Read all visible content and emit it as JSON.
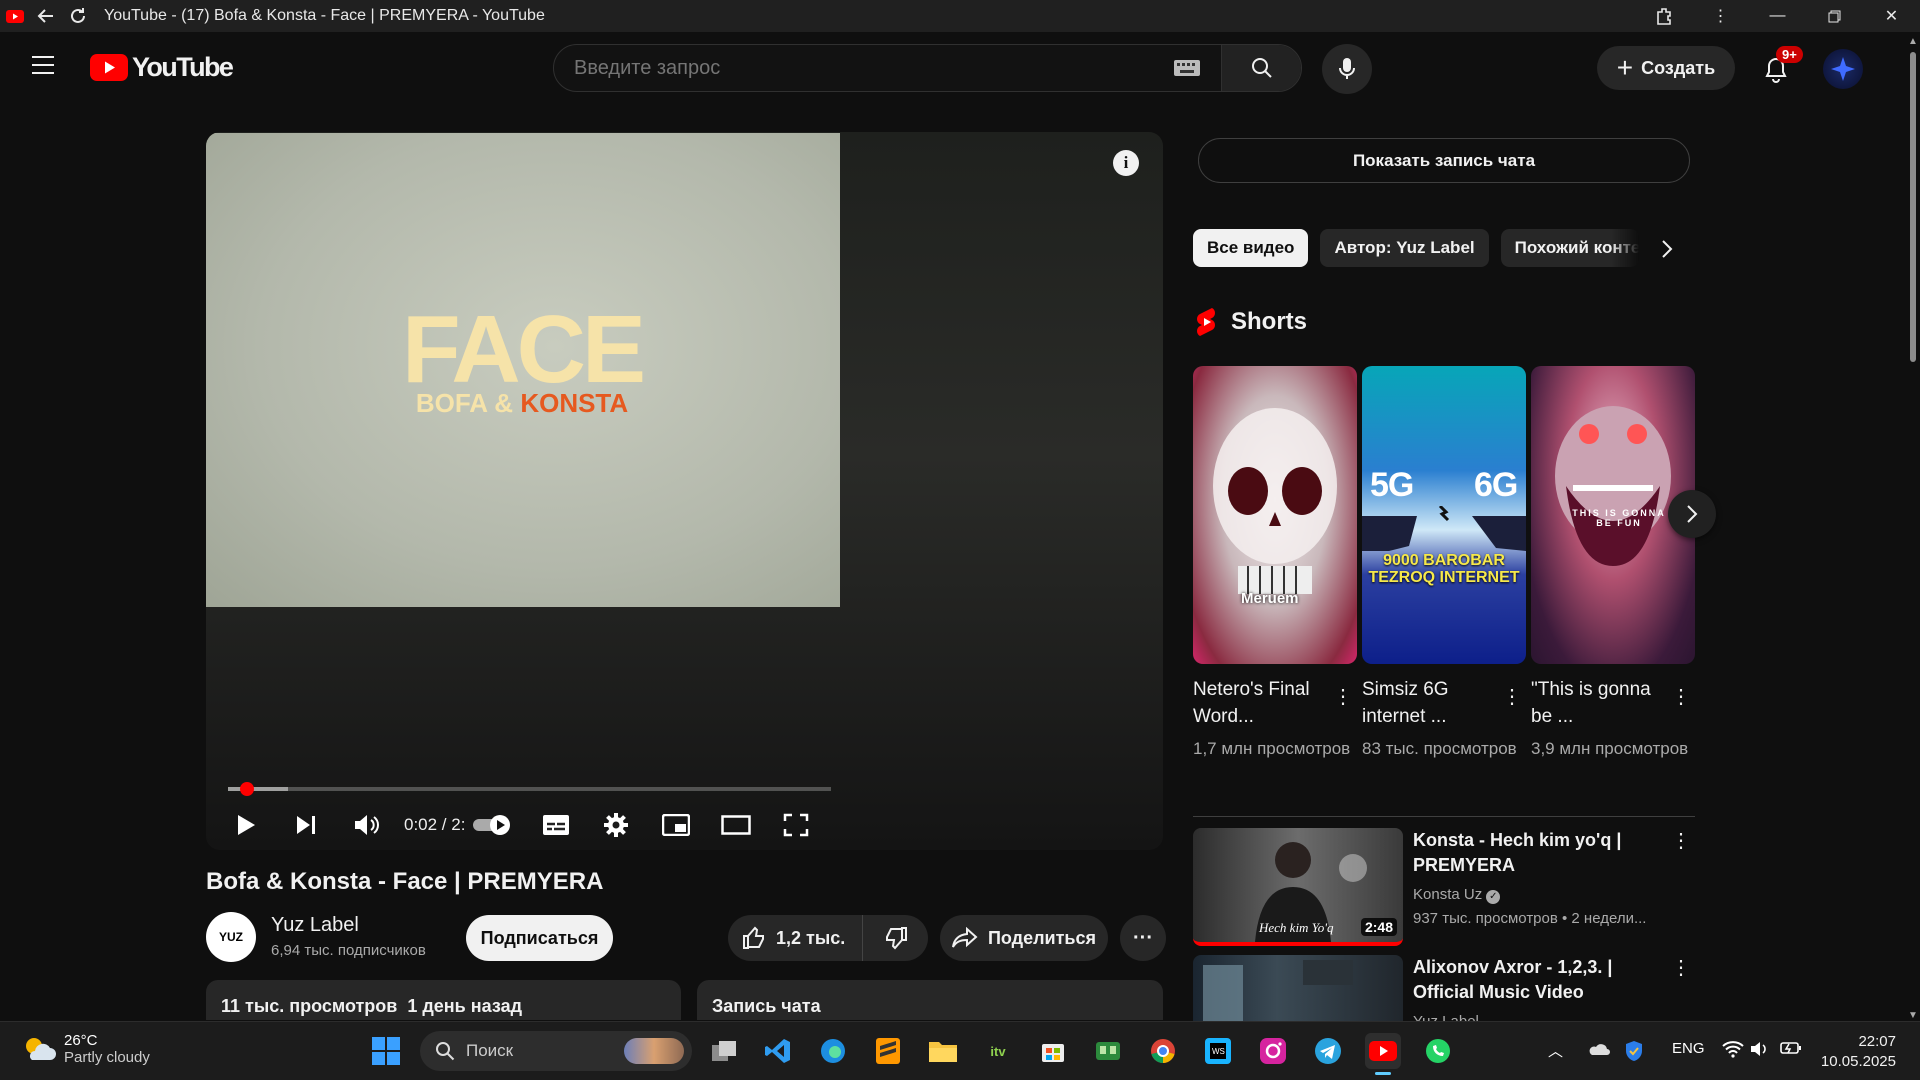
{
  "browser": {
    "title": "YouTube - (17) Bofa & Konsta - Face | PREMYERA - YouTube"
  },
  "header": {
    "logo_text": "YouTube",
    "search_placeholder": "Введите запрос",
    "create_label": "Создать",
    "notif_badge": "9+"
  },
  "player": {
    "cover_title": "FACE",
    "cover_artist_left": "BOFA &",
    "cover_artist_right": "KONSTA",
    "time": "0:02 / 2:",
    "progress_fraction": 0.02
  },
  "video": {
    "title": "Bofa & Konsta - Face | PREMYERA",
    "channel": "Yuz Label",
    "channel_avatar_text": "YUZ",
    "subscribers": "6,94 тыс. подписчиков",
    "subscribe_label": "Подписаться",
    "likes": "1,2 тыс.",
    "share_label": "Поделиться",
    "more_label": "···",
    "views_date": "11 тыс. просмотров  1 день назад",
    "chat_record_label": "Запись чата"
  },
  "sidebar": {
    "show_chat": "Показать запись чата",
    "chips": [
      "Все видео",
      "Автор: Yuz Label",
      "Похожий конте"
    ],
    "shorts_heading": "Shorts",
    "shorts": [
      {
        "title": "Netero's Final Word...",
        "views": "1,7 млн просмотров",
        "thumb_text": "Meruem"
      },
      {
        "title": "Simsiz 6G internet ...",
        "views": "83 тыс. просмотров",
        "thumb_text_1": "5G",
        "thumb_text_2": "6G",
        "thumb_caption": "9000 BAROBAR TEZROQ INTERNET"
      },
      {
        "title": "\"This is gonna be ...",
        "views": "3,9 млн просмотров",
        "thumb_text": "THIS IS GONNA BE FUN"
      }
    ],
    "recommended": [
      {
        "title": "Konsta - Hech kim yo'q | PREMYERA",
        "channel": "Konsta Uz",
        "meta": "937 тыс. просмотров • 2 недели...",
        "duration": "2:48",
        "thumb_text": "Hech kim Yo'q"
      },
      {
        "title": "Alixonov Axror - 1,2,3. | Official Music Video",
        "channel": "Yuz Label",
        "meta": "",
        "duration": ""
      }
    ]
  },
  "taskbar": {
    "temp": "26°C",
    "weather": "Partly cloudy",
    "search_label": "Поиск",
    "lang": "ENG",
    "time": "22:07",
    "date": "10.05.2025"
  }
}
